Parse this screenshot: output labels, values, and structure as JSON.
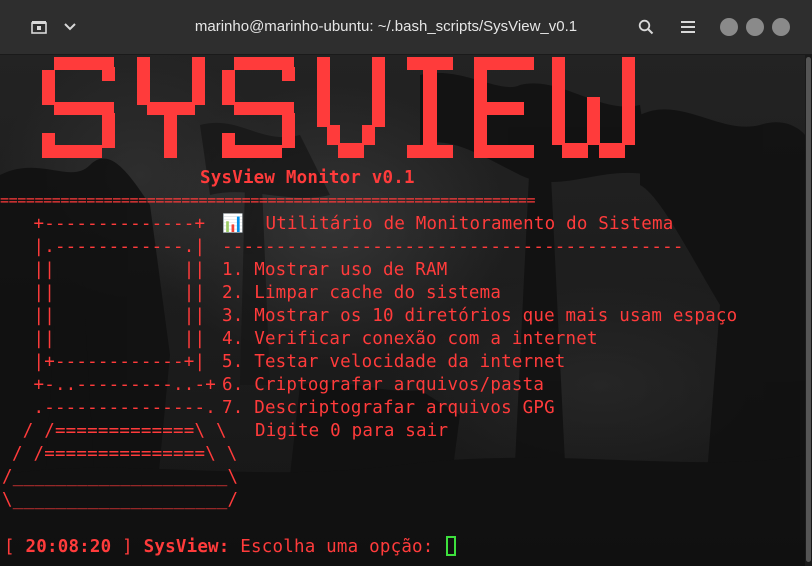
{
  "window": {
    "title": "marinho@marinho-ubuntu: ~/.bash_scripts/SysView_v0.1"
  },
  "toolbar": {
    "new_tab_icon": "terminal-tab-icon",
    "menu_icon": "chevron-down-icon",
    "search_icon": "search-icon",
    "hamburger_icon": "menu-icon"
  },
  "banner": {
    "logo_text": "SYSVIEW",
    "subtitle": "SysView Monitor v0.1",
    "rule": "=============================================================="
  },
  "menu": {
    "header_icon": "📊",
    "header": "Utilitário de Monitoramento do Sistema",
    "header_rule": "-------------------------------------------",
    "items": [
      "1. Mostrar uso de RAM",
      "2. Limpar cache do sistema",
      "3. Mostrar os 10 diretórios que mais usam espaço",
      "4. Verificar conexão com a internet",
      "5. Testar velocidade da internet",
      "6. Criptografar arquivos/pasta",
      "7. Descriptografar arquivos GPG"
    ],
    "exit": "Digite 0 para sair"
  },
  "ascii_art": [
    "  +--------------+",
    "  |.------------.|",
    "  ||            ||",
    "  ||            ||",
    "  ||            ||",
    "  ||            ||",
    "  |+------------+|",
    "  +-..---------..-+",
    "  .---------------.",
    " / /=============\\ \\",
    "/ /===============\\ \\",
    "/____________________\\",
    "\\____________________/"
  ],
  "prompt": {
    "open": "[",
    "time": "20:08:20",
    "close": "]",
    "name": "SysView:",
    "text": "Escolha uma opção:"
  },
  "colors": {
    "accent_red": "#ff3b3b",
    "cursor_green": "#3de03d",
    "titlebar": "#2e2e2e"
  }
}
